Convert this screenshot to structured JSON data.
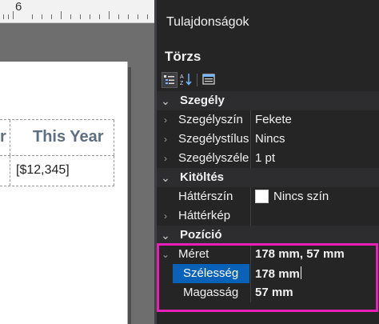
{
  "ruler": {
    "number": "6"
  },
  "report": {
    "header_prev": "r",
    "header_this": "This Year",
    "value_this": "[$12,345]"
  },
  "pane": {
    "title": "Tulajdonságok",
    "object_name": "Törzs",
    "toolbar": {
      "buttons": [
        "categorized-icon",
        "alphabetical-icon",
        "property-pages-icon"
      ]
    },
    "categories": {
      "border": "Szegély",
      "fill": "Kitöltés",
      "position": "Pozíció"
    },
    "props": {
      "border_color": {
        "name": "Szegélyszín",
        "value": "Fekete"
      },
      "border_style": {
        "name": "Szegélystílus",
        "value": "Nincs"
      },
      "border_width": {
        "name": "Szegélyszélesség",
        "value": "1 pt"
      },
      "bg_color": {
        "name": "Háttérszín",
        "value": "Nincs szín"
      },
      "bg_image": {
        "name": "Háttérkép",
        "value": ""
      },
      "size": {
        "name": "Méret",
        "value": "178 mm, 57 mm"
      },
      "width": {
        "name": "Szélesség",
        "value": "178 mm"
      },
      "height": {
        "name": "Magasság",
        "value": "57 mm"
      }
    }
  },
  "colors": {
    "pane_bg": "#252526",
    "selection": "#0a61b8",
    "highlight": "#e820b8",
    "header_text": "#5f6f82"
  }
}
